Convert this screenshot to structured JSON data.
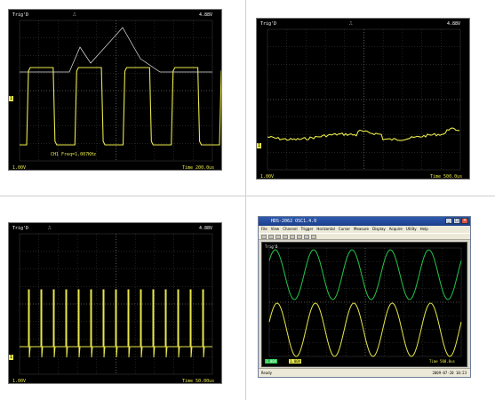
{
  "colors": {
    "trace_yellow": "#e8e84a",
    "trace_green": "#22c84a",
    "trace_ref": "#e0e0e0",
    "screen_bg": "#000000",
    "grid": "#6b6b6b"
  },
  "scope_top_left": {
    "status": "Trig'D",
    "trigger_text": "4.88V",
    "channel_marker": "1",
    "measure_label": "CH1 Freq=1.007KHz",
    "ch_scale": "1.00V",
    "timebase": "Time 200.0us"
  },
  "scope_top_right": {
    "status": "Trig'D",
    "trigger_text": "4.88V",
    "channel_marker": "1",
    "ch_scale": "1.00V",
    "timebase": "Time 500.0us"
  },
  "scope_bottom_left": {
    "status": "Trig'D",
    "trigger_text": "4.88V",
    "channel_marker": "1",
    "ch_scale": "1.00V",
    "timebase": "Time 50.00us"
  },
  "window": {
    "title": "HDS-2062 OSC1.4.0",
    "menu": [
      "File",
      "View",
      "Channel",
      "Trigger",
      "Horizontal",
      "Cursor",
      "Measure",
      "Display",
      "Acquire",
      "Utility",
      "Help"
    ],
    "screen_status": "Trig'D",
    "ch1_label": "1.00V",
    "ch2_label": "1.00V",
    "timebase": "Time 500.0us",
    "status_left": "Ready",
    "status_right": "2009-07-20 10:23"
  }
}
